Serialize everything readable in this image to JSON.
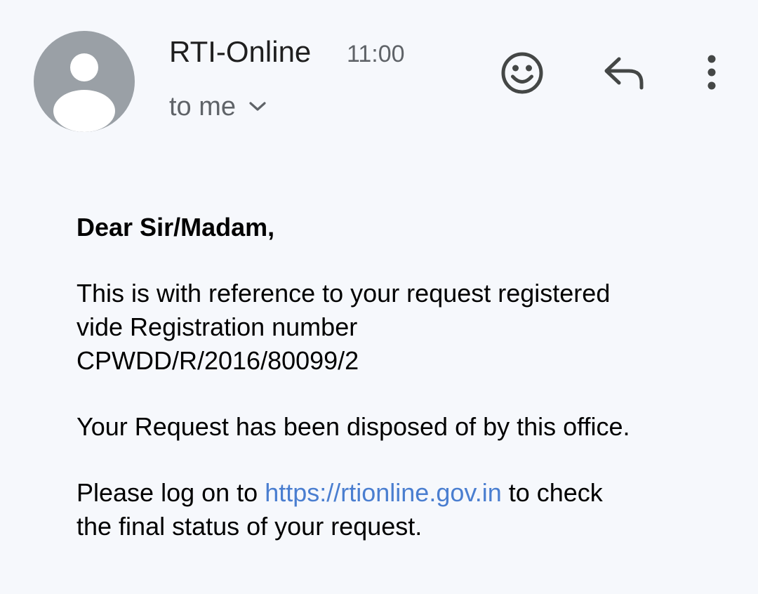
{
  "header": {
    "sender_name": "RTI-Online",
    "time": "11:00",
    "recipient_label": "to me",
    "avatar_icon": "person-icon",
    "actions": {
      "emoji_icon": "emoji-icon",
      "reply_icon": "reply-icon",
      "more_icon": "more-vert-icon"
    }
  },
  "body": {
    "greeting": "Dear Sir/Madam,",
    "para1_line1": "This is with reference to your request registered",
    "para1_line2": "vide Registration number",
    "para1_line3": "CPWDD/R/2016/80099/2",
    "para2": "Your Request has been disposed of by this office.",
    "para3_prefix": "Please log on to ",
    "para3_link": "https://rtionline.gov.in",
    "para3_suffix": " to check",
    "para3_line2": "the final status of your request."
  },
  "colors": {
    "background": "#f6f8fc",
    "avatar": "#9aa0a6",
    "link": "#4a7ed0",
    "icon": "#444746",
    "secondary_text": "#5f6368"
  }
}
